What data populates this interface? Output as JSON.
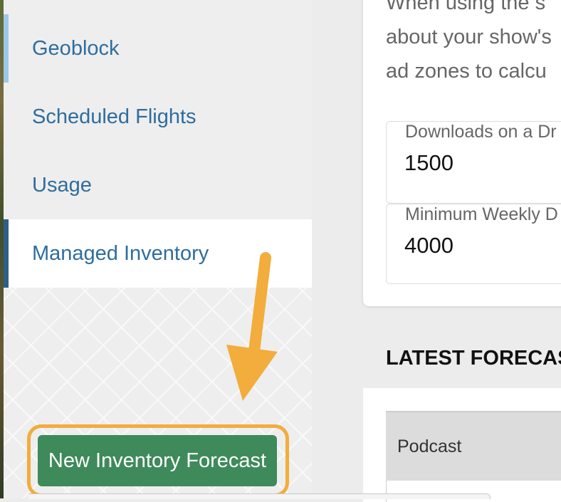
{
  "sidebar": {
    "items": [
      {
        "label": "Geoblock"
      },
      {
        "label": "Scheduled Flights"
      },
      {
        "label": "Usage"
      },
      {
        "label": "Managed Inventory"
      }
    ],
    "new_forecast_button": "New Inventory Forecast"
  },
  "settings_card": {
    "intro_lines": [
      "When using the s",
      "about your show's",
      "ad zones to calcu"
    ],
    "fields": [
      {
        "label": "Downloads on a Dr",
        "value": "1500"
      },
      {
        "label": "Minimum Weekly D",
        "value": "4000"
      }
    ]
  },
  "latest_forecasts": {
    "title": "LATEST FORECAS",
    "columns": [
      "Podcast"
    ]
  },
  "colors": {
    "link": "#2e6d9e",
    "active_marker": "#2e5f86",
    "button": "#3e8a5a",
    "highlight": "#f2ad3d"
  }
}
